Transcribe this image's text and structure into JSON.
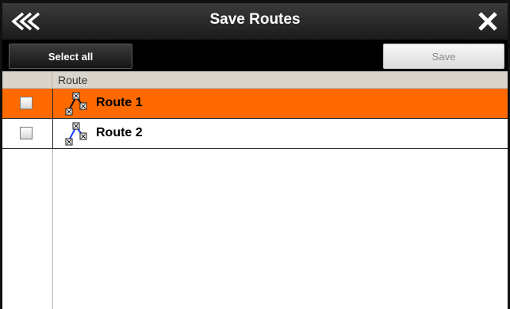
{
  "app": {
    "title": "Save Routes",
    "back_icon": "triple-chevron-left-icon",
    "close_icon": "close-icon"
  },
  "toolbar": {
    "select_all_label": "Select all",
    "save_label": "Save"
  },
  "table": {
    "columns": [
      "",
      "Route"
    ],
    "rows": [
      {
        "name": "Route 1",
        "checked": false,
        "selected": true,
        "icon": "route-icon"
      },
      {
        "name": "Route 2",
        "checked": false,
        "selected": false,
        "icon": "route-icon"
      }
    ]
  },
  "colors": {
    "accent": "#ff6a00",
    "titlebar": "#1b1b1b",
    "header_bg": "#d9d4cc"
  }
}
